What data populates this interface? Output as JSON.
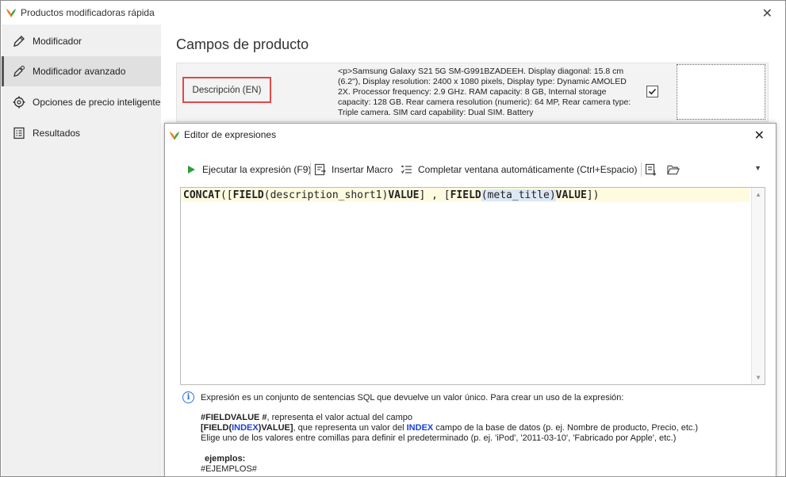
{
  "window": {
    "title": "Productos modificadoras rápida",
    "close_glyph": "✕"
  },
  "sidebar": {
    "items": [
      {
        "label": "Modificador",
        "icon": "pencil-icon"
      },
      {
        "label": "Modificador avanzado",
        "icon": "edit-gear-icon"
      },
      {
        "label": "Opciones de precio inteligente",
        "icon": "price-gear-icon"
      },
      {
        "label": "Resultados",
        "icon": "list-icon"
      }
    ],
    "active_index": 1
  },
  "main": {
    "title": "Campos de producto",
    "field": {
      "label": "Descripción (EN)",
      "value": "<p>Samsung Galaxy S21 5G SM-G991BZADEEH. Display diagonal: 15.8 cm (6.2\"), Display resolution: 2400 x 1080 pixels, Display type: Dynamic AMOLED 2X. Processor frequency: 2.9 GHz. RAM capacity: 8 GB, Internal storage capacity: 128 GB. Rear camera resolution (numeric): 64 MP, Rear camera type: Triple camera. SIM card capability: Dual SIM. Battery",
      "checked": true
    }
  },
  "dialog": {
    "title": "Editor de expresiones",
    "close_glyph": "✕",
    "toolbar": {
      "run_label": "Ejecutar la expresión (F9)",
      "insert_macro_label": "Insertar Macro",
      "autocomplete_label": "Completar ventana automáticamente (Ctrl+Espacio)",
      "dropdown_glyph": "▼"
    },
    "editor": {
      "concat": "CONCAT",
      "p1": "([",
      "field1": "FIELD",
      "arg1": "(description_short1)",
      "value1": "VALUE",
      "mid": "] , [",
      "field2": "FIELD",
      "arg2": "(meta_title)",
      "value2": "VALUE",
      "end": "])"
    },
    "help": {
      "intro": "Expresión es un conjunto de sentencias SQL que devuelve un valor único. Para crear un uso de la expresión:",
      "line1_bold": "#FIELDVALUE #",
      "line1_rest": ", representa el valor actual del campo",
      "line2_a": "[FIELD(",
      "line2_index": "INDEX",
      "line2_b": ")VALUE]",
      "line2_rest_a": ", que representa un valor del ",
      "line2_index2": "INDEX",
      "line2_rest_b": " campo de la base de datos (p. ej. Nombre de producto, Precio, etc.)",
      "line3": "Elige uno de los valores entre comillas para definir el predeterminado (p. ej. 'iPod', '2011-03-10', 'Fabricado por Apple', etc.)",
      "examples_label": "ejemplos:",
      "examples_value": "#EJEMPLOS#"
    }
  },
  "colors": {
    "highlight_border": "#e04848",
    "keyword_blue": "#1a3fd6",
    "run_green": "#2e9e3e",
    "editor_line": "#fffbe0"
  }
}
